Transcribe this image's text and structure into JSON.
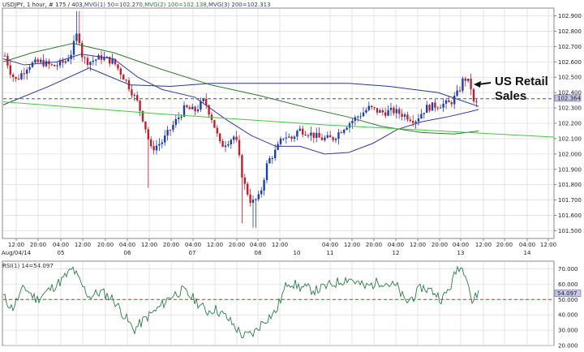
{
  "header": {
    "symbol": "USDJPY",
    "info": ", 1 hour, # 175 / 403,",
    "ma1_label": "MVG(1) 50=102.270,",
    "ma2_label": "MVG(2) 100=102.138,",
    "ma3_label": "MVG(3) 200=102.313"
  },
  "colors": {
    "bull": "#1e3ea8",
    "bear": "#c0202e",
    "ma50": "#3a3aa0",
    "ma100": "#2f7a2f",
    "ma200": "#233a8a",
    "trendline": "#40c840",
    "resistance": "#4a4a9a",
    "rsi_line": "#2f7a4a",
    "rsi_ref": "#d03030",
    "grid": "#d6d6d6"
  },
  "annotation": {
    "line1": "US Retail",
    "line2": "Sales"
  },
  "chart_data": [
    {
      "type": "candlestick",
      "title": "USDJPY , 1 hour",
      "ylim": [
        101.45,
        102.95
      ],
      "y_ticks": [
        "102.900",
        "102.800",
        "102.700",
        "102.600",
        "102.500",
        "102.400",
        "102.300",
        "102.200",
        "102.100",
        "102.000",
        "101.900",
        "101.800",
        "101.700",
        "101.600",
        "101.500"
      ],
      "current_price": "102.364",
      "x_time_labels": [
        "12:00",
        "20:00",
        "04:00",
        "12:00",
        "20:00",
        "04:00",
        "12:00",
        "20:00",
        "04:00",
        "12:00",
        "20:00",
        "04:00",
        "12:00",
        "04:00",
        "12:00",
        "20:00",
        "04:00",
        "12:00",
        "20:00",
        "04:00",
        "12:00",
        "20:00",
        "04:00",
        "12:00"
      ],
      "x_date_labels": [
        "Aug/04/14",
        "05",
        "06",
        "07",
        "08",
        "10",
        "11",
        "12",
        "13",
        "14"
      ],
      "grid": true,
      "horizontal_line": 102.36,
      "moving_averages": [
        {
          "name": "MVG(1) 50",
          "value": 102.27
        },
        {
          "name": "MVG(2) 100",
          "value": 102.138
        },
        {
          "name": "MVG(3) 200",
          "value": 102.313
        }
      ]
    },
    {
      "type": "line",
      "title": "RSI(1) 14=54.097",
      "ylim": [
        20,
        75
      ],
      "y_ticks": [
        "70.000",
        "60.000",
        "50.000",
        "40.000",
        "30.000",
        "20.000"
      ],
      "current_value": "54.097",
      "reference_level": 50,
      "grid": true
    }
  ]
}
